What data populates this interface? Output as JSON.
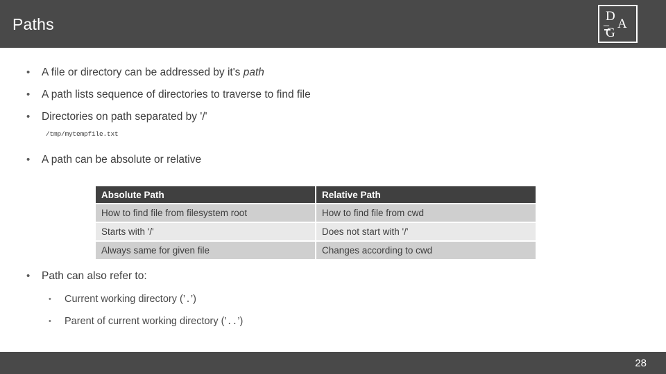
{
  "slide": {
    "title": "Paths",
    "page_number": "28",
    "header_color": "#494949",
    "footer_color": "#494949",
    "background_color": "#ffffff",
    "body_text_color": "#3d3d3d"
  },
  "logo": {
    "letter_1": "D",
    "dash": "–",
    "letter_2": "A",
    "letter_3": "G"
  },
  "bullets": [
    {
      "marker": "•",
      "text_before": "A file or directory can be addressed by it's ",
      "emphasis": "path",
      "text_after": ""
    },
    {
      "marker": "•",
      "text_before": "A path lists sequence of directories to traverse to find file",
      "emphasis": "",
      "text_after": ""
    },
    {
      "marker": "•",
      "text_before": "Directories on path separated by '/'",
      "emphasis": "",
      "text_after": ""
    },
    {
      "marker": "•",
      "text_before": "A path can be absolute or relative",
      "emphasis": "",
      "text_after": ""
    },
    {
      "marker": "•",
      "text_before": "Path can also refer to:",
      "emphasis": "",
      "text_after": ""
    }
  ],
  "code_note": "/tmp/mytempfile.txt",
  "sub_bullets": [
    {
      "marker": "•",
      "text_before": "Current working directory (’",
      "dots": ".",
      "text_after": "’)"
    },
    {
      "marker": "•",
      "text_before": "Parent of current working directory (’",
      "dots": "..",
      "text_after": "’)"
    }
  ],
  "table": {
    "headers": [
      "Absolute Path",
      "Relative Path"
    ],
    "rows": [
      [
        "How to find file from filesystem root",
        "How to find file from cwd"
      ],
      [
        "Starts with '/'",
        "Does not start with '/'"
      ],
      [
        "Always same for given file",
        "Changes according to cwd"
      ]
    ],
    "header_bg": "#404040",
    "row_bg_odd": "#cfcfcf",
    "row_bg_even": "#e9e9e9"
  }
}
